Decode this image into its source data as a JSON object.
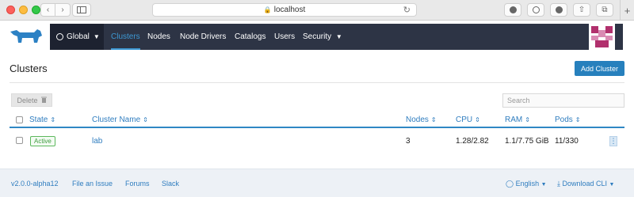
{
  "browser": {
    "url": "localhost",
    "icons": [
      "back-icon",
      "forward-icon",
      "sidebar-icon",
      "lock-icon",
      "reload-icon",
      "download-icon",
      "info-icon",
      "extension-icon",
      "share-icon",
      "tabs-icon",
      "plus-icon"
    ],
    "new_tab_label": "+"
  },
  "nav": {
    "global": "Global",
    "items": [
      "Clusters",
      "Nodes",
      "Node Drivers",
      "Catalogs",
      "Users",
      "Security"
    ],
    "active": "Clusters",
    "colors": {
      "bar": "#2d3445",
      "global": "#1d2230",
      "accent": "#3d98d3"
    }
  },
  "page": {
    "title": "Clusters",
    "add_button": "Add Cluster",
    "delete_button": "Delete",
    "search_placeholder": "Search"
  },
  "table": {
    "columns": [
      "State",
      "Cluster Name",
      "Nodes",
      "CPU",
      "RAM",
      "Pods"
    ],
    "rows": [
      {
        "state": "Active",
        "name": "lab",
        "nodes": "3",
        "cpu": "1.28/2.82",
        "ram": "1.1/7.75 GiB",
        "pods": "11/330"
      }
    ]
  },
  "footer": {
    "version": "v2.0.0-alpha12",
    "file_issue": "File an Issue",
    "forums": "Forums",
    "slack": "Slack",
    "language": "English",
    "download": "Download CLI"
  }
}
